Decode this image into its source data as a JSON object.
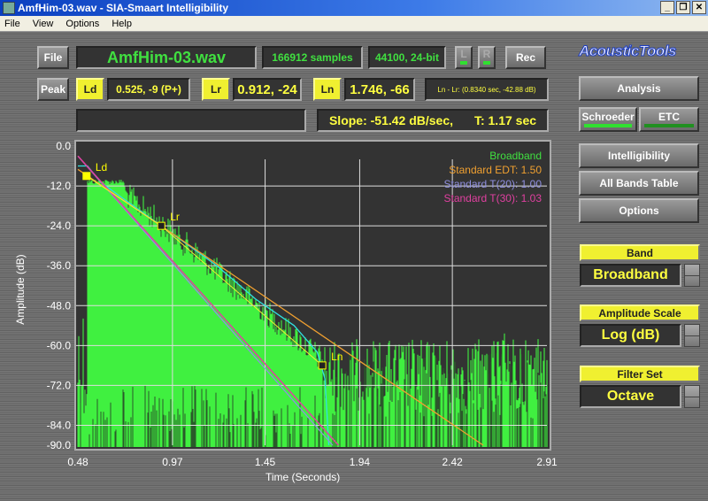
{
  "window": {
    "title": "AmfHim-03.wav - SIA-Smaart Intelligibility",
    "controls": [
      "_",
      "❐",
      "✕"
    ]
  },
  "menu": [
    "File",
    "View",
    "Options",
    "Help"
  ],
  "toolbar": {
    "file_btn": "File",
    "filename": "AmfHim-03.wav",
    "samples": "166912 samples",
    "format": "44100, 24-bit",
    "l": "L",
    "r": "R",
    "rec": "Rec",
    "peak_btn": "Peak",
    "ld_label": "Ld",
    "ld_value": "0.525, -9 (P+)",
    "lr_label": "Lr",
    "lr_value": "0.912, -24",
    "ln_label": "Ln",
    "ln_value": "1.746, -66",
    "ln_lr": "Ln - Lr: (0.8340 sec, -42.88 dB)",
    "message": "",
    "slope": "Slope: -51.42 dB/sec,",
    "t": "T: 1.17 sec"
  },
  "logo": "AcousticTools",
  "side": {
    "analysis": "Analysis",
    "schroeder": "Schroeder",
    "etc": "ETC",
    "intelligibility": "Intelligibility",
    "all_bands": "All Bands Table",
    "options": "Options",
    "band_label": "Band",
    "band_value": "Broadband",
    "amp_label": "Amplitude Scale",
    "amp_value": "Log (dB)",
    "filter_label": "Filter Set",
    "filter_value": "Octave"
  },
  "chart_data": {
    "type": "line",
    "xlabel": "Time (Seconds)",
    "ylabel": "Amplitude (dB)",
    "xlim": [
      0.48,
      2.91
    ],
    "ylim": [
      -90,
      0
    ],
    "xticks": [
      "0.48",
      "0.97",
      "1.45",
      "1.94",
      "2.42",
      "2.91"
    ],
    "yticks": [
      "0.0",
      "-12.0",
      "-24.0",
      "-36.0",
      "-48.0",
      "-60.0",
      "-72.0",
      "-84.0",
      "-90.0"
    ],
    "grid": true,
    "legend_placement": "top-right",
    "legend": [
      {
        "text": "Broadband",
        "color": "#40e040"
      },
      {
        "text": "Standard EDT: 1.50",
        "color": "#f0a030"
      },
      {
        "text": "Standard T(20): 1.00",
        "color": "#9090e0"
      },
      {
        "text": "Standard T(30): 1.03",
        "color": "#e040a0"
      }
    ],
    "markers": [
      {
        "label": "Ld",
        "x": 0.525,
        "y": -9
      },
      {
        "label": "Lr",
        "x": 0.912,
        "y": -24
      },
      {
        "label": "Ln",
        "x": 1.746,
        "y": -66
      }
    ],
    "lines": {
      "edt": [
        [
          0.48,
          -7
        ],
        [
          2.58,
          -90
        ]
      ],
      "t20": [
        [
          0.48,
          -3
        ],
        [
          1.8,
          -90
        ]
      ],
      "t30": [
        [
          0.48,
          -3
        ],
        [
          1.83,
          -90
        ]
      ],
      "schroeder": [
        [
          0.48,
          -6
        ],
        [
          0.53,
          -6
        ],
        [
          0.6,
          -11
        ],
        [
          0.912,
          -24
        ],
        [
          1.2,
          -36
        ],
        [
          1.4,
          -46
        ],
        [
          1.6,
          -54
        ],
        [
          1.72,
          -62
        ],
        [
          1.76,
          -70
        ],
        [
          1.78,
          -90
        ]
      ]
    },
    "colors": {
      "signal": "#40f040",
      "schroeder": "#30e0e0",
      "fit": "#f0f030"
    }
  }
}
